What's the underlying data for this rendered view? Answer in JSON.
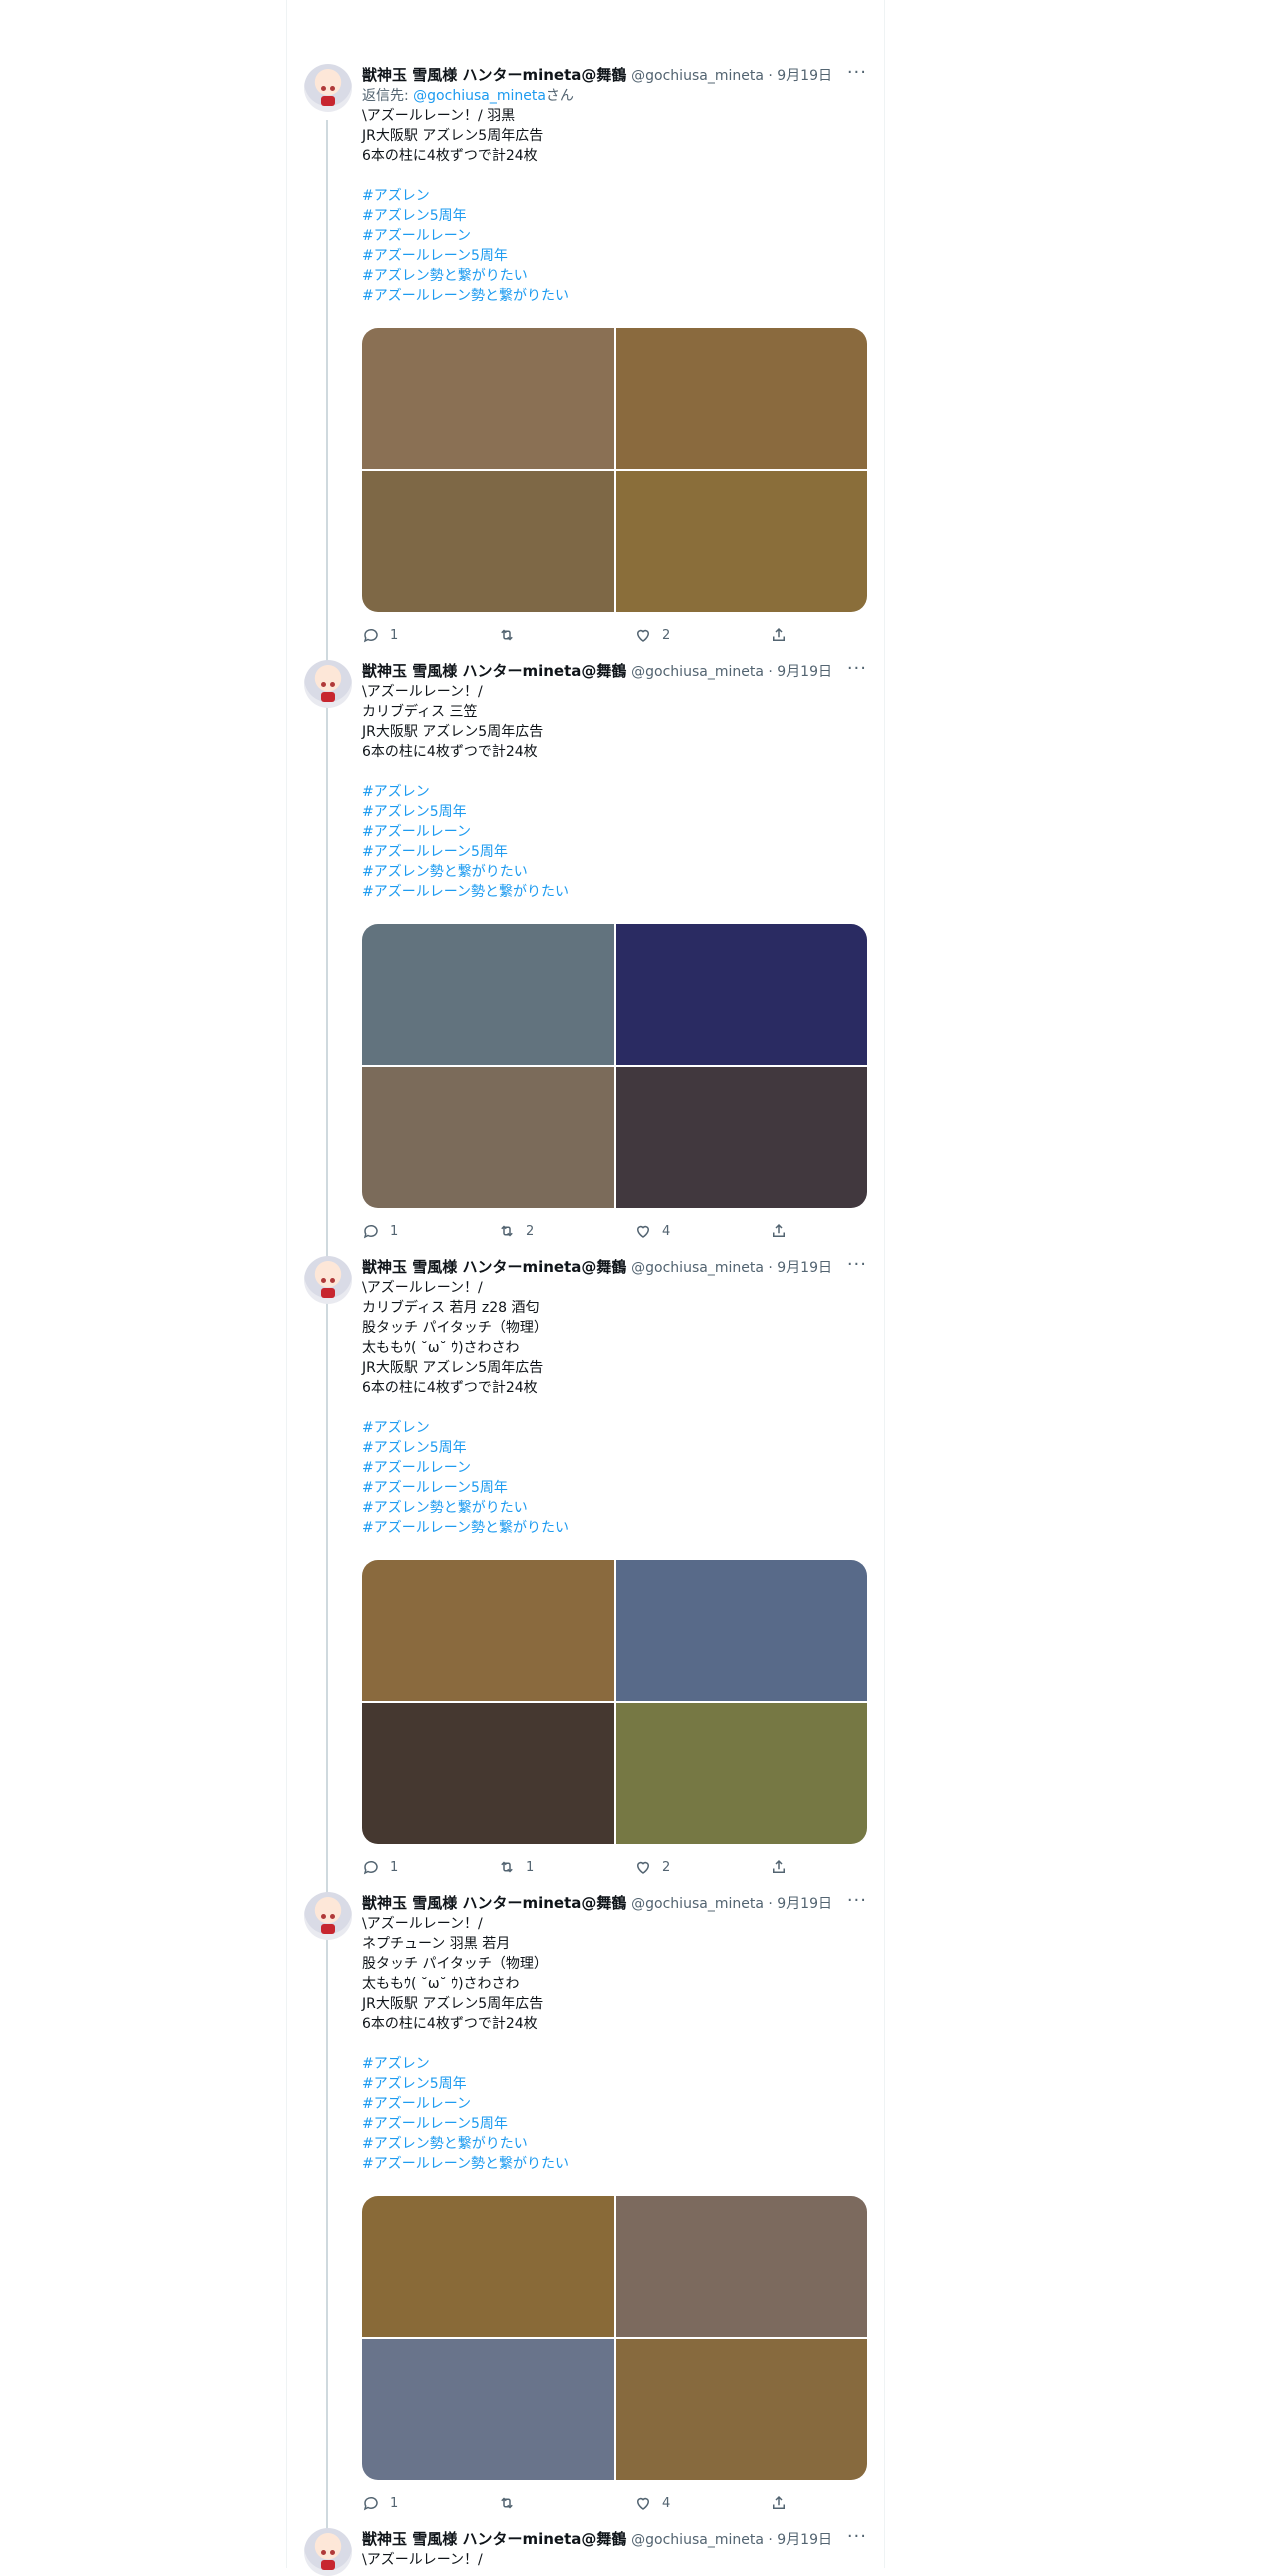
{
  "author": {
    "name": "獣神玉 雪風様 ハンターmineta@舞鶴",
    "handle": "@gochiusa_mineta",
    "date": "9月19日",
    "more": "···"
  },
  "reply_to": {
    "prefix": "返信先: ",
    "handle": "@gochiusa_mineta",
    "suffix": "さん"
  },
  "hashtags": [
    "#アズレン",
    "#アズレン5周年",
    "#アズールレーン",
    "#アズールレーン5周年",
    "#アズレン勢と繋がりたい",
    "#アズールレーン勢と繋がりたい"
  ],
  "tweets": [
    {
      "lines": [
        "\\アズールレーン！/ 羽黒",
        "JR大阪駅 アズレン5周年広告",
        "6本の柱に4枚ずつで計24枚"
      ],
      "colors": [
        "#8a7054",
        "#8a6a3e",
        "#7e6846",
        "#8a6e3a"
      ],
      "stats": {
        "reply": "1",
        "retweet": "",
        "like": "2"
      }
    },
    {
      "lines": [
        "\\アズールレーン！/",
        "カリブディス 三笠",
        "JR大阪駅 アズレン5周年広告",
        "6本の柱に4枚ずつで計24枚"
      ],
      "colors": [
        "#62737e",
        "#2a2b62",
        "#7b6b5a",
        "#41383e"
      ],
      "stats": {
        "reply": "1",
        "retweet": "2",
        "like": "4"
      }
    },
    {
      "lines": [
        "\\アズールレーン！/",
        "カリブディス 若月 z28 酒匂",
        "股タッチ パイタッチ（物理）",
        "太ももｳ( ˘ω˘ ｳ)さわさわ",
        "JR大阪駅 アズレン5周年広告",
        "6本の柱に4枚ずつで計24枚"
      ],
      "colors": [
        "#8a6a3e",
        "#586a89",
        "#453830",
        "#767844"
      ],
      "stats": {
        "reply": "1",
        "retweet": "1",
        "like": "2"
      }
    },
    {
      "lines": [
        "\\アズールレーン！/",
        "ネプチューン 羽黒 若月",
        "股タッチ パイタッチ（物理）",
        "太ももｳ( ˘ω˘ ｳ)さわさわ",
        "JR大阪駅 アズレン5周年広告",
        "6本の柱に4枚ずつで計24枚"
      ],
      "colors": [
        "#896a38",
        "#7c6a5e",
        "#69748b",
        "#876a3e"
      ],
      "stats": {
        "reply": "1",
        "retweet": "",
        "like": "4"
      }
    },
    {
      "lines": [
        "\\アズールレーン！/"
      ]
    }
  ]
}
